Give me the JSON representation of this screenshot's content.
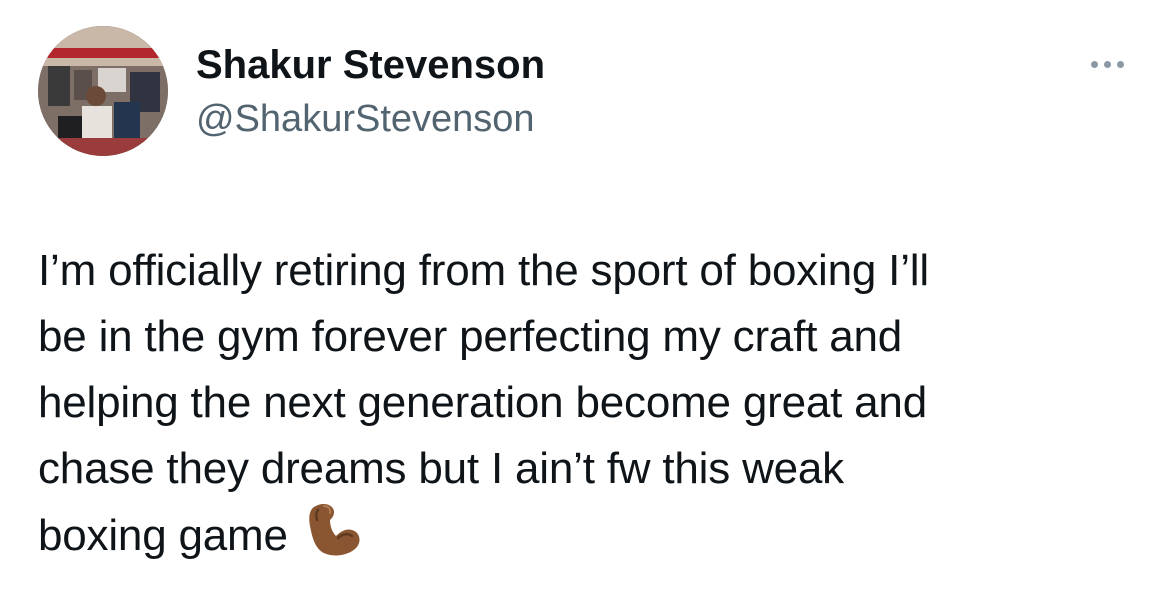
{
  "author": {
    "display_name": "Shakur Stevenson",
    "handle": "@ShakurStevenson"
  },
  "tweet": {
    "lines": [
      "I’m officially retiring from the sport of boxing I’ll",
      "be in the gym forever perfecting my craft and",
      "helping the next generation become great and",
      "chase they dreams but I ain’t fw this weak",
      "boxing game"
    ],
    "emoji": "flexed-biceps-icon"
  },
  "colors": {
    "text": "#0f1419",
    "secondary": "#536471",
    "more_dots": "#8b98a5"
  }
}
